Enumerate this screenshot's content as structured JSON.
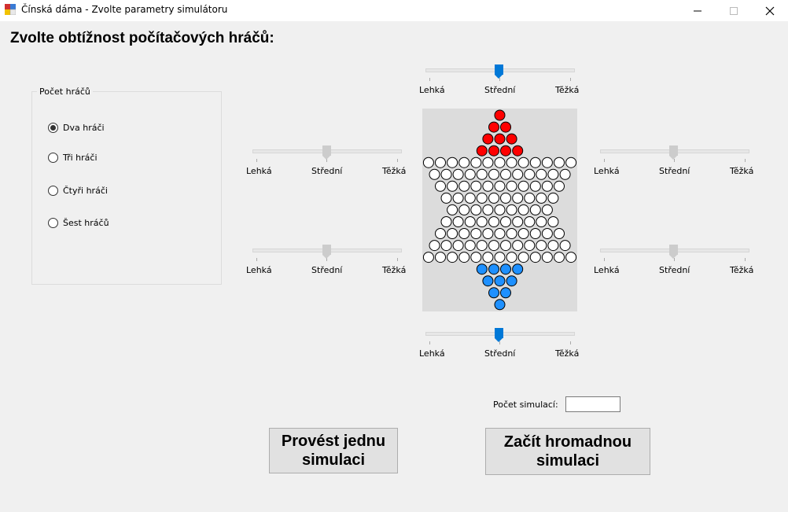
{
  "window": {
    "title": "Čínská dáma - Zvolte parametry simulátoru",
    "controls": [
      "minimize-icon",
      "maximize-icon",
      "close-icon"
    ]
  },
  "heading": "Zvolte obtížnost počítačových hráčů:",
  "players_group": {
    "legend": "Počet hráčů",
    "options": [
      {
        "label": "Dva hráči",
        "checked": true
      },
      {
        "label": "Tři hráči",
        "checked": false
      },
      {
        "label": "Čtyři hráči",
        "checked": false
      },
      {
        "label": "Šest hráčů",
        "checked": false
      }
    ]
  },
  "difficulty_labels": {
    "easy": "Lehká",
    "medium": "Střední",
    "hard": "Těžká"
  },
  "sliders": [
    {
      "id": "top",
      "value": "Střední",
      "enabled": true
    },
    {
      "id": "left-upper",
      "value": "Střední",
      "enabled": false
    },
    {
      "id": "right-upper",
      "value": "Střední",
      "enabled": false
    },
    {
      "id": "left-lower",
      "value": "Střední",
      "enabled": false
    },
    {
      "id": "right-lower",
      "value": "Střední",
      "enabled": false
    },
    {
      "id": "bottom",
      "value": "Střední",
      "enabled": true
    }
  ],
  "board": {
    "colors": {
      "red": "#ff0000",
      "blue": "#1e90ff",
      "empty": "#ffffff",
      "background": "#dcdcdc"
    },
    "row_counts": [
      1,
      2,
      3,
      4,
      13,
      12,
      11,
      10,
      9,
      10,
      11,
      12,
      13,
      4,
      3,
      2,
      1
    ],
    "red_rows": [
      0,
      1,
      2,
      3
    ],
    "blue_rows": [
      13,
      14,
      15,
      16
    ]
  },
  "simulation": {
    "count_label": "Počet simulací:",
    "count_value": "",
    "single_button": "Provést jednu simulaci",
    "batch_button": "Začít hromadnou simulaci"
  }
}
